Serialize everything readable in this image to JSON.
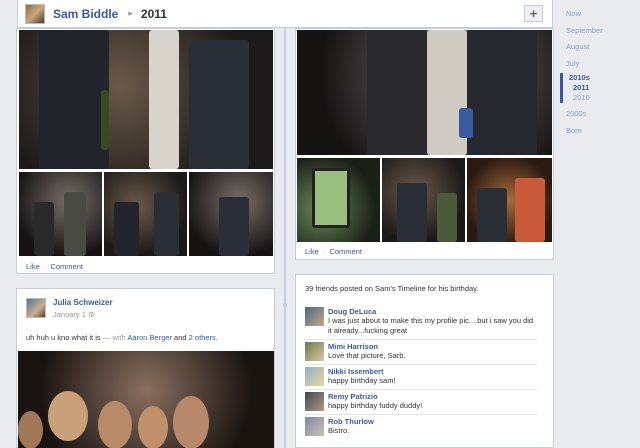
{
  "header": {
    "name": "Sam Biddle",
    "separator": "▸",
    "year": "2011",
    "add_label": "+"
  },
  "photo_card_left": {
    "like": "Like",
    "comment": "Comment",
    "sep": "·"
  },
  "photo_card_right": {
    "like": "Like",
    "comment": "Comment",
    "sep": "·"
  },
  "post": {
    "author": "Julia Schweizer",
    "date": "January 1",
    "text": "uh huh u kno what it is",
    "with_prefix": "— with",
    "tagged": "Aaron Berger",
    "and": "and",
    "others": "2 others."
  },
  "birthday": {
    "title": "39 friends posted on Sam's Timeline for his birthday.",
    "posts": [
      {
        "name": "Doug DeLuca",
        "message": "I was just about to make this my profile pic....but i saw you did it already...fucking great"
      },
      {
        "name": "Mimi Harrison",
        "message": "Love that picture, Sarb."
      },
      {
        "name": "Nikki Issembert",
        "message": "happy birthday sam!"
      },
      {
        "name": "Remy Patrizio",
        "message": "happy birthday fuddy duddy!"
      },
      {
        "name": "Rob Thurlow",
        "message": "Bistro."
      }
    ]
  },
  "scrubber": {
    "now": "Now",
    "september": "September",
    "august": "August",
    "july": "July",
    "decade": "2010s",
    "y2011": "2011",
    "y2010": "2010",
    "d2000": "2000s",
    "born": "Born"
  },
  "colors": {
    "link": "#3b5998",
    "border": "#c4cde0",
    "background": "#e9ebee"
  }
}
